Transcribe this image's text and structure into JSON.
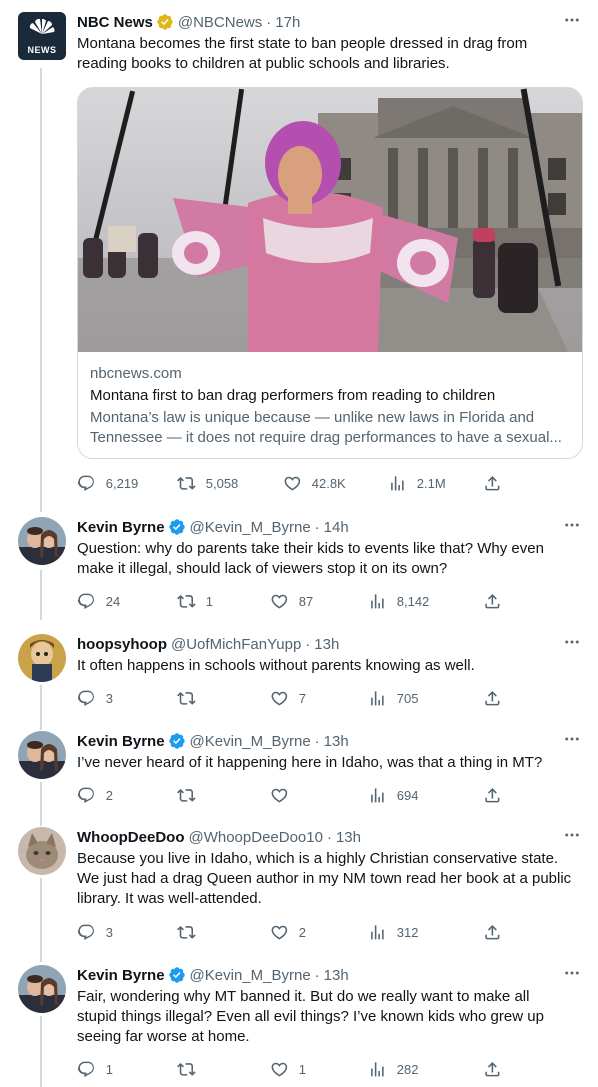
{
  "colors": {
    "text_primary": "#0f1419",
    "text_secondary": "#536471",
    "verified_blue": "#1d9bf0",
    "verified_gold": "#e2b719",
    "border": "#cfd9de",
    "nbc_logo_bg": "#1b2a3a"
  },
  "tweets": [
    {
      "author_name": "NBC News",
      "verified": "gold",
      "handle": "@NBCNews",
      "separator": "·",
      "time": "17h",
      "avatar_icon": "nbc-news-peacock-logo",
      "avatar_text": "NEWS",
      "text": "Montana becomes the first state to ban people dressed in drag from reading books to children at public schools and libraries.",
      "card": {
        "domain": "nbcnews.com",
        "title": "Montana first to ban drag performers from reading to children",
        "description": "Montana’s law is unique because — unlike new laws in Florida and Tennessee — it does not require drag performances to have a sexual..."
      },
      "replies": "6,219",
      "retweets": "5,058",
      "likes": "42.8K",
      "views": "2.1M"
    },
    {
      "author_name": "Kevin Byrne",
      "verified": "blue",
      "handle": "@Kevin_M_Byrne",
      "separator": "·",
      "time": "14h",
      "avatar_icon": "couple-photo-avatar",
      "text": "Question: why do parents take their kids to events like that? Why even make it illegal, should lack of viewers stop it on its own?",
      "replies": "24",
      "retweets": "1",
      "likes": "87",
      "views": "8,142"
    },
    {
      "author_name": "hoopsyhoop",
      "verified": "",
      "handle": "@UofMichFanYupp",
      "separator": "·",
      "time": "13h",
      "avatar_icon": "cartoon-character-avatar",
      "text": "It often happens in schools without parents knowing as well.",
      "replies": "3",
      "retweets": "",
      "likes": "7",
      "views": "705"
    },
    {
      "author_name": "Kevin Byrne",
      "verified": "blue",
      "handle": "@Kevin_M_Byrne",
      "separator": "·",
      "time": "13h",
      "avatar_icon": "couple-photo-avatar",
      "text": "I’ve never heard of it happening here in Idaho, was that a thing in MT?",
      "replies": "2",
      "retweets": "",
      "likes": "",
      "views": "694"
    },
    {
      "author_name": "WhoopDeeDoo",
      "verified": "",
      "handle": "@WhoopDeeDoo10",
      "separator": "·",
      "time": "13h",
      "avatar_icon": "cat-photo-avatar",
      "text": "Because you live in Idaho, which is a highly Christian conservative state. We just had a drag Queen author in my NM town read her book at a public library. It was well-attended.",
      "replies": "3",
      "retweets": "",
      "likes": "2",
      "views": "312"
    },
    {
      "author_name": "Kevin Byrne",
      "verified": "blue",
      "handle": "@Kevin_M_Byrne",
      "separator": "·",
      "time": "13h",
      "avatar_icon": "couple-photo-avatar",
      "text": "Fair, wondering why MT banned it. But do we really want to make all stupid things illegal? Even all evil things? I’ve known kids who grew up seeing far worse at home.",
      "replies": "1",
      "retweets": "",
      "likes": "1",
      "views": "282"
    }
  ]
}
